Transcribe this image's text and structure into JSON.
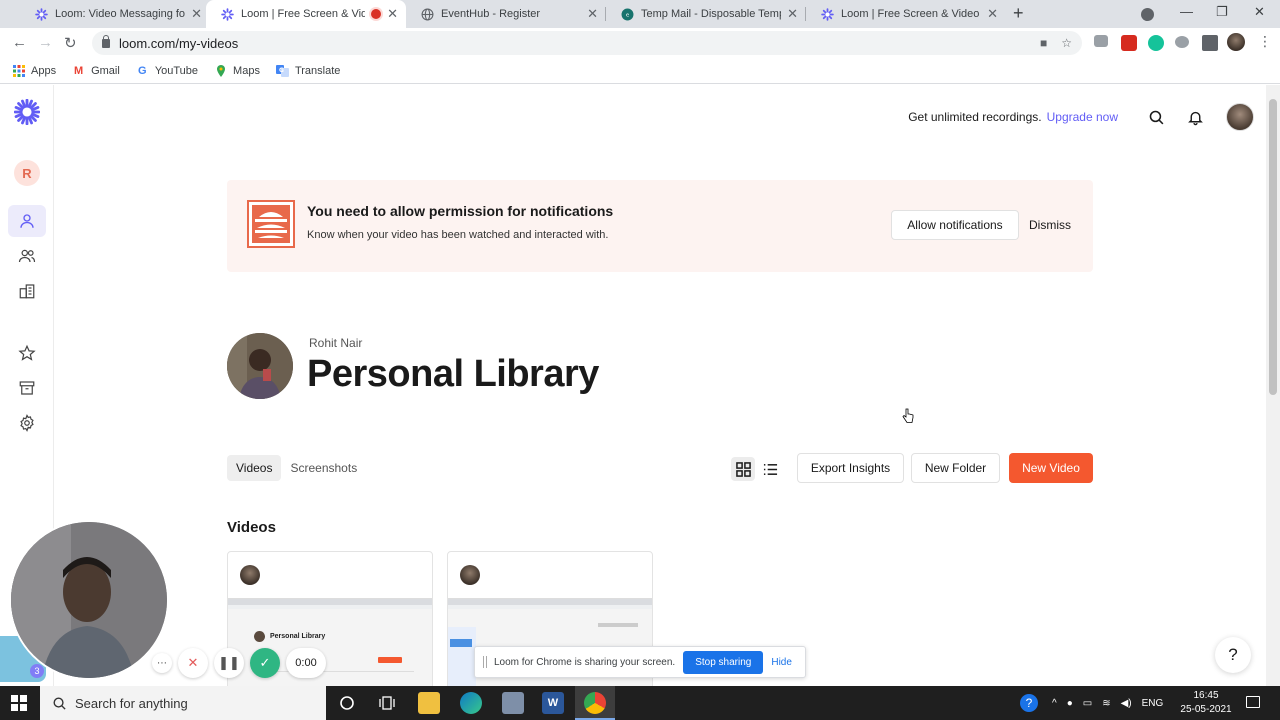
{
  "browser": {
    "tabs": [
      {
        "title": "Loom: Video Messaging for Work",
        "active": false,
        "recording": false
      },
      {
        "title": "Loom | Free Screen & Video Recording",
        "active": true,
        "recording": true
      },
      {
        "title": "EventHub - Register",
        "active": false,
        "recording": false
      },
      {
        "title": "Temp Mail - Disposable Temporary Email",
        "active": false,
        "recording": false
      },
      {
        "title": "Loom | Free Screen & Video Recording",
        "active": false,
        "recording": false
      }
    ],
    "url": "loom.com/my-videos",
    "bookmarks": [
      "Apps",
      "Gmail",
      "YouTube",
      "Maps",
      "Translate"
    ]
  },
  "sidebar": {
    "workspace_initial": "R",
    "items": [
      "my-library",
      "team",
      "workspace",
      "favorites",
      "archive",
      "settings"
    ],
    "active": "my-library"
  },
  "header": {
    "upgrade_text": "Get unlimited recordings.",
    "upgrade_link": "Upgrade now"
  },
  "notice": {
    "title": "You need to allow permission for notifications",
    "subtitle": "Know when your video has been watched and interacted with.",
    "allow_label": "Allow notifications",
    "dismiss_label": "Dismiss"
  },
  "library": {
    "owner": "Rohit Nair",
    "title": "Personal Library",
    "tabs": [
      "Videos",
      "Screenshots"
    ],
    "active_tab": "Videos",
    "view": "grid",
    "export_label": "Export Insights",
    "new_folder_label": "New Folder",
    "new_video_label": "New Video",
    "section_title": "Videos",
    "thumb_caption": "Personal Library"
  },
  "recorder": {
    "timer": "0:00",
    "badge_count": "3"
  },
  "share_bar": {
    "message": "Loom for Chrome is sharing your screen.",
    "stop_label": "Stop sharing",
    "hide_label": "Hide"
  },
  "help": {
    "label": "?"
  },
  "taskbar": {
    "search_placeholder": "Search for anything",
    "language": "ENG",
    "time": "16:45",
    "date": "25-05-2021"
  },
  "colors": {
    "accent": "#625df5",
    "primary_button": "#f4582f",
    "notice_bg": "#fdf3f1",
    "done_green": "#2fb683",
    "chrome_blue": "#1a73e8"
  }
}
